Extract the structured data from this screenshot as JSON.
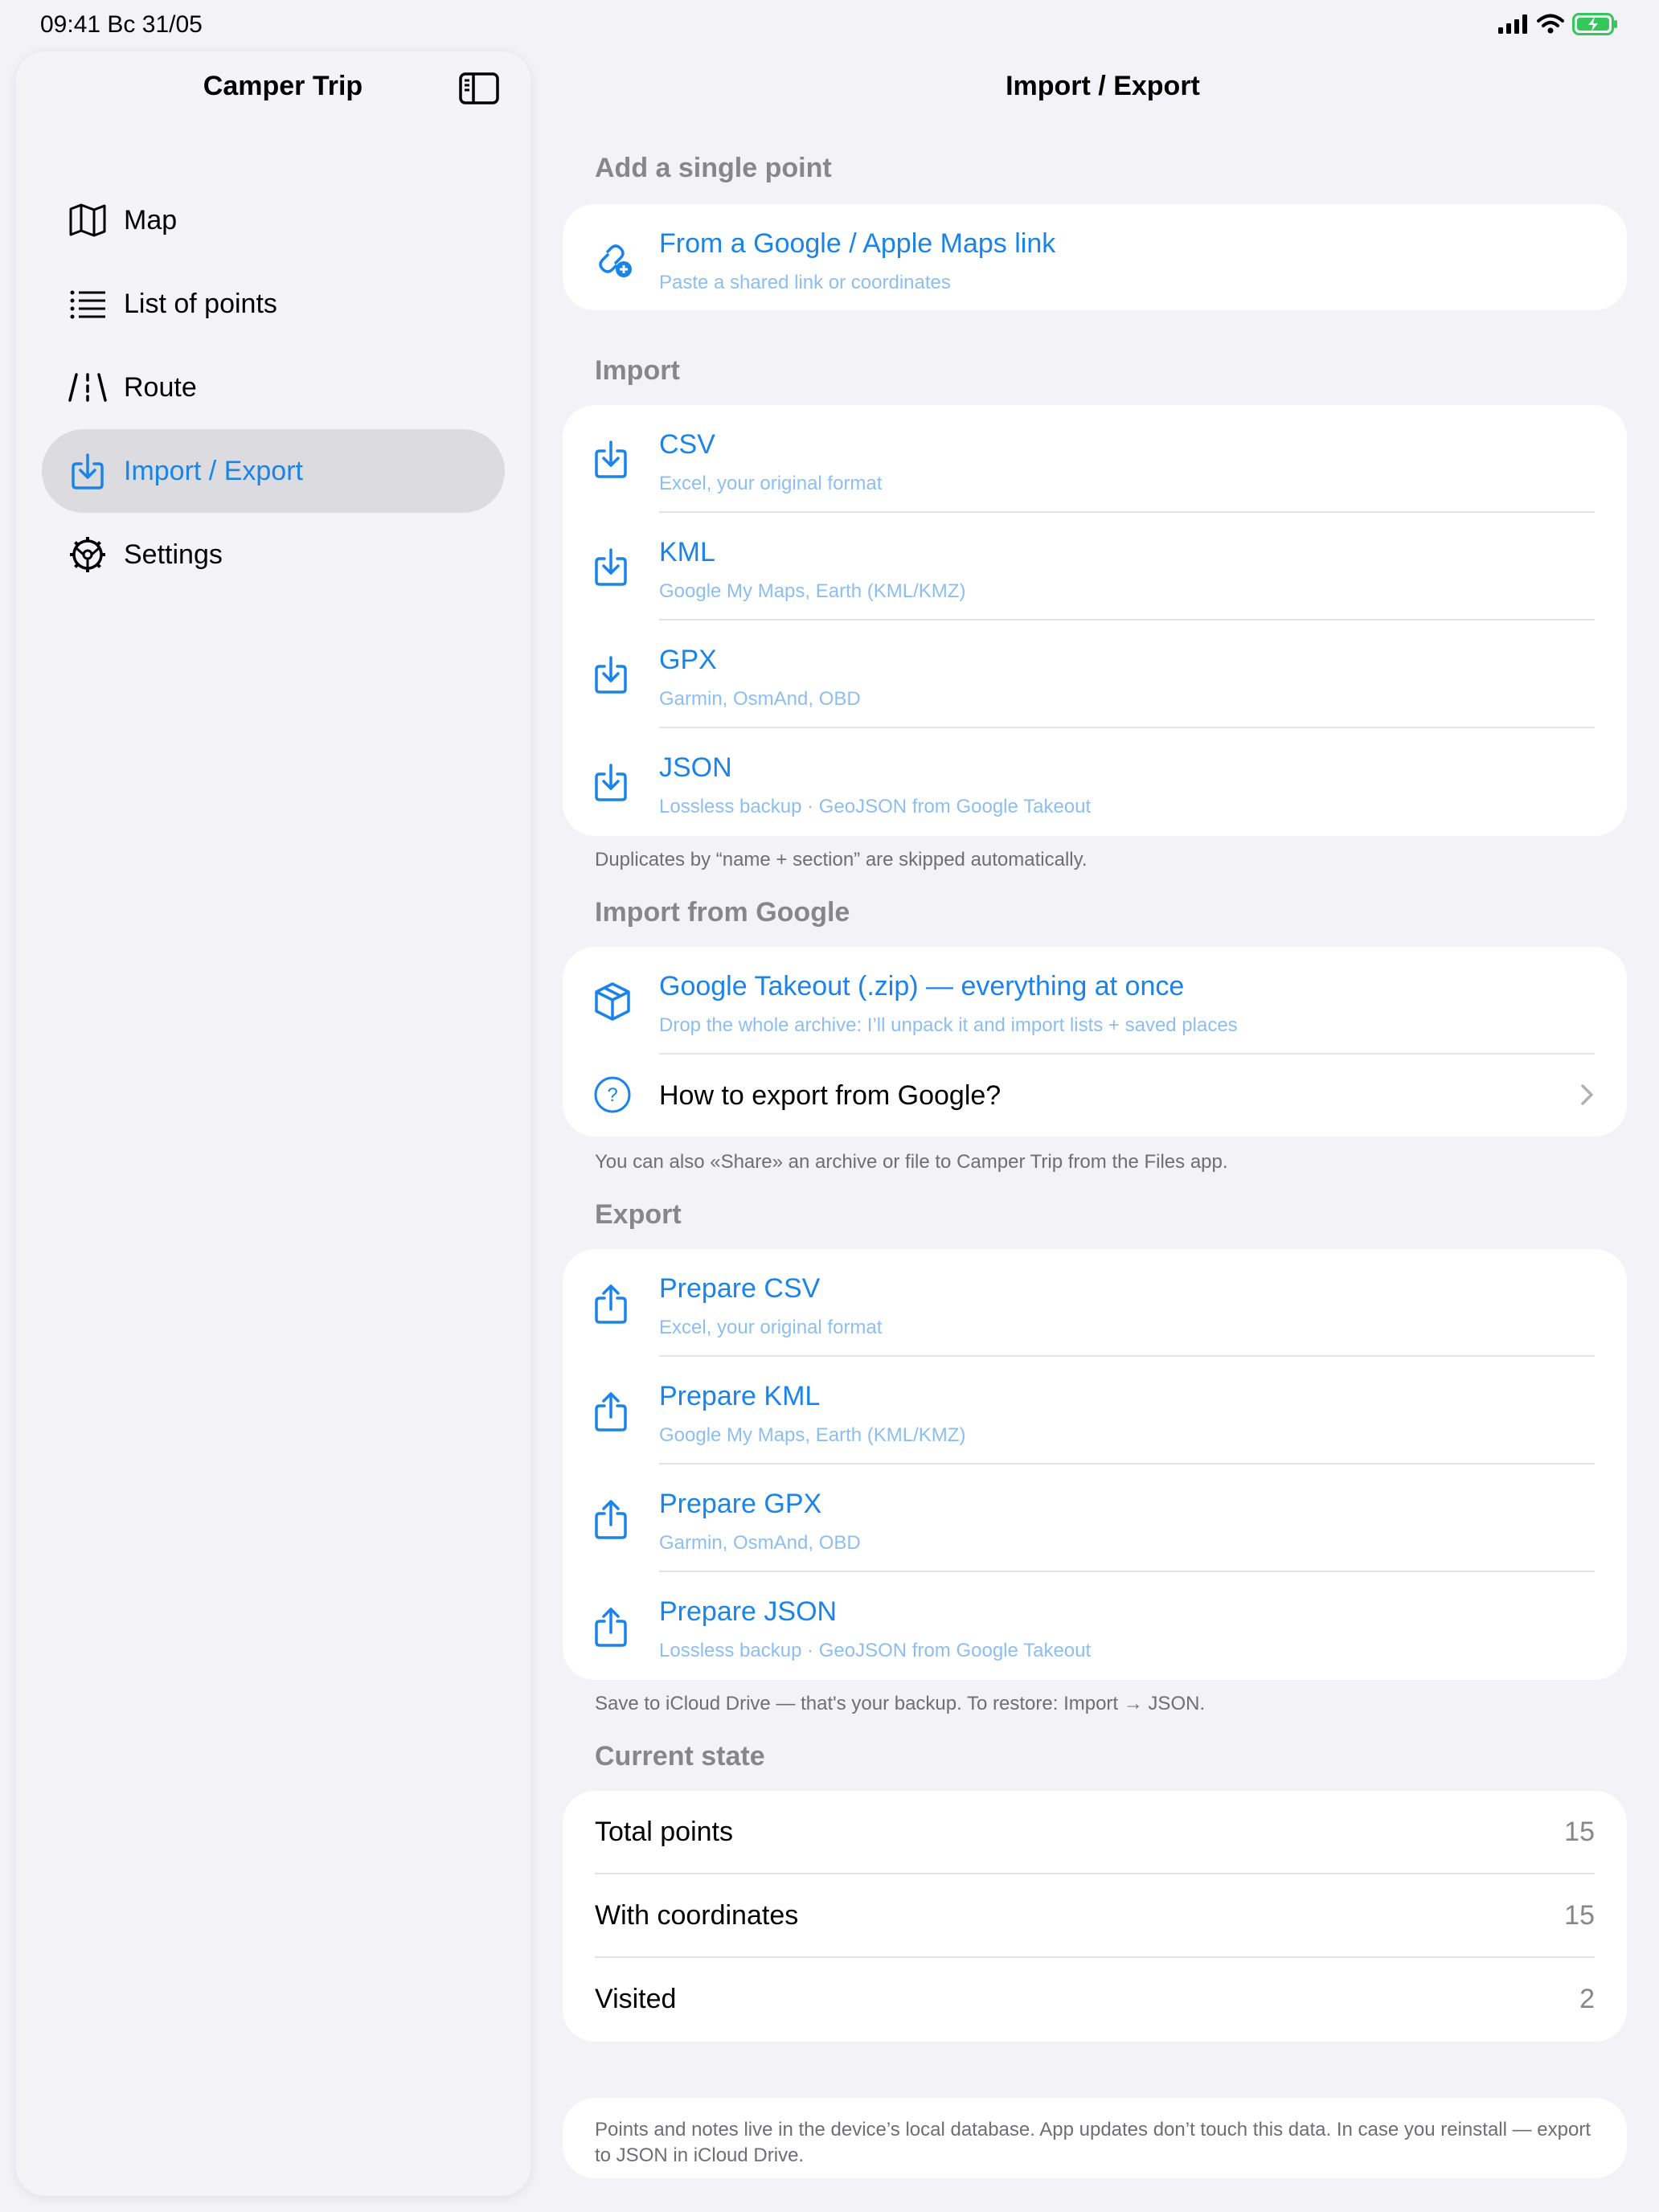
{
  "status_bar": {
    "time": "09:41  Вс 31/05",
    "icons": [
      "signal-icon",
      "wifi-icon",
      "battery-icon"
    ]
  },
  "sidebar": {
    "title": "Camper Trip",
    "items": [
      {
        "label": "Map",
        "icon": "map-icon"
      },
      {
        "label": "List of points",
        "icon": "list-icon"
      },
      {
        "label": "Route",
        "icon": "road-icon"
      },
      {
        "label": "Import / Export",
        "icon": "import-icon",
        "selected": true
      },
      {
        "label": "Settings",
        "icon": "gear-icon"
      }
    ]
  },
  "main": {
    "title": "Import / Export",
    "single_point": {
      "header": "Add a single point",
      "row": {
        "title": "From a Google / Apple Maps link",
        "subtitle": "Paste a shared link or coordinates"
      }
    },
    "import": {
      "header": "Import",
      "rows": [
        {
          "title": "CSV",
          "subtitle": "Excel, your original format"
        },
        {
          "title": "KML",
          "subtitle": "Google My Maps, Earth (KML/KMZ)"
        },
        {
          "title": "GPX",
          "subtitle": "Garmin, OsmAnd, OBD"
        },
        {
          "title": "JSON",
          "subtitle": "Lossless backup · GeoJSON from Google Takeout"
        }
      ],
      "note": "Duplicates by “name + section” are skipped automatically."
    },
    "google": {
      "header": "Import from Google",
      "takeout": {
        "title": "Google Takeout (.zip) — everything at once",
        "subtitle": "Drop the whole archive: I’ll unpack it and import lists + saved places"
      },
      "howto": "How to export from Google?",
      "note": "You can also «Share» an archive or file to Camper Trip from the Files app."
    },
    "export": {
      "header": "Export",
      "rows": [
        {
          "title": "Prepare CSV",
          "subtitle": "Excel, your original format"
        },
        {
          "title": "Prepare KML",
          "subtitle": "Google My Maps, Earth (KML/KMZ)"
        },
        {
          "title": "Prepare GPX",
          "subtitle": "Garmin, OsmAnd, OBD"
        },
        {
          "title": "Prepare JSON",
          "subtitle": "Lossless backup · GeoJSON from Google Takeout"
        }
      ],
      "note": "Save to iCloud Drive — that's your backup. To restore: Import → JSON."
    },
    "state": {
      "header": "Current state",
      "rows": [
        {
          "label": "Total points",
          "value": "15"
        },
        {
          "label": "With coordinates",
          "value": "15"
        },
        {
          "label": "Visited",
          "value": "2"
        }
      ]
    },
    "info": "Points and notes live in the device’s local database. App updates don’t touch this data. In case you reinstall — export to JSON in iCloud Drive."
  },
  "colors": {
    "accent": "#1a84e8",
    "background": "#f2f2f7",
    "secondary_text": "#86868b",
    "battery": "#34c759"
  }
}
